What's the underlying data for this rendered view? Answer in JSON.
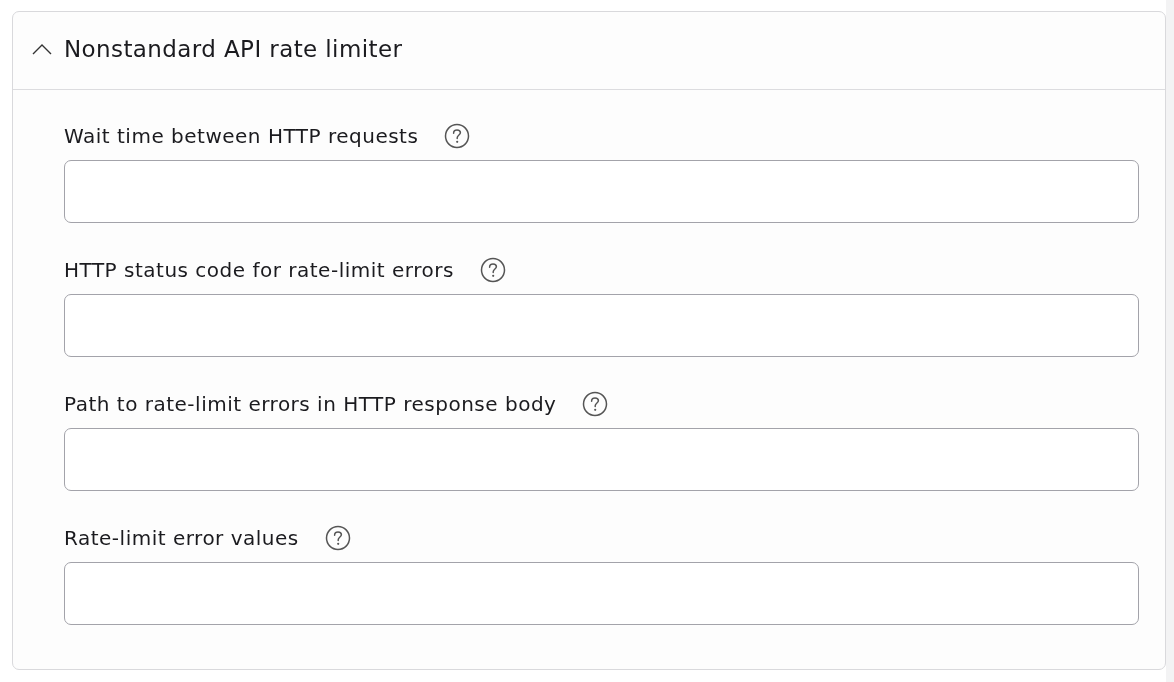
{
  "section": {
    "title": "Nonstandard API rate limiter",
    "expanded": true
  },
  "fields": [
    {
      "label": "Wait time between HTTP requests"
    },
    {
      "label": "HTTP status code for rate-limit errors"
    },
    {
      "label": "Path to rate-limit errors in HTTP response body"
    },
    {
      "label": "Rate-limit error values"
    }
  ]
}
